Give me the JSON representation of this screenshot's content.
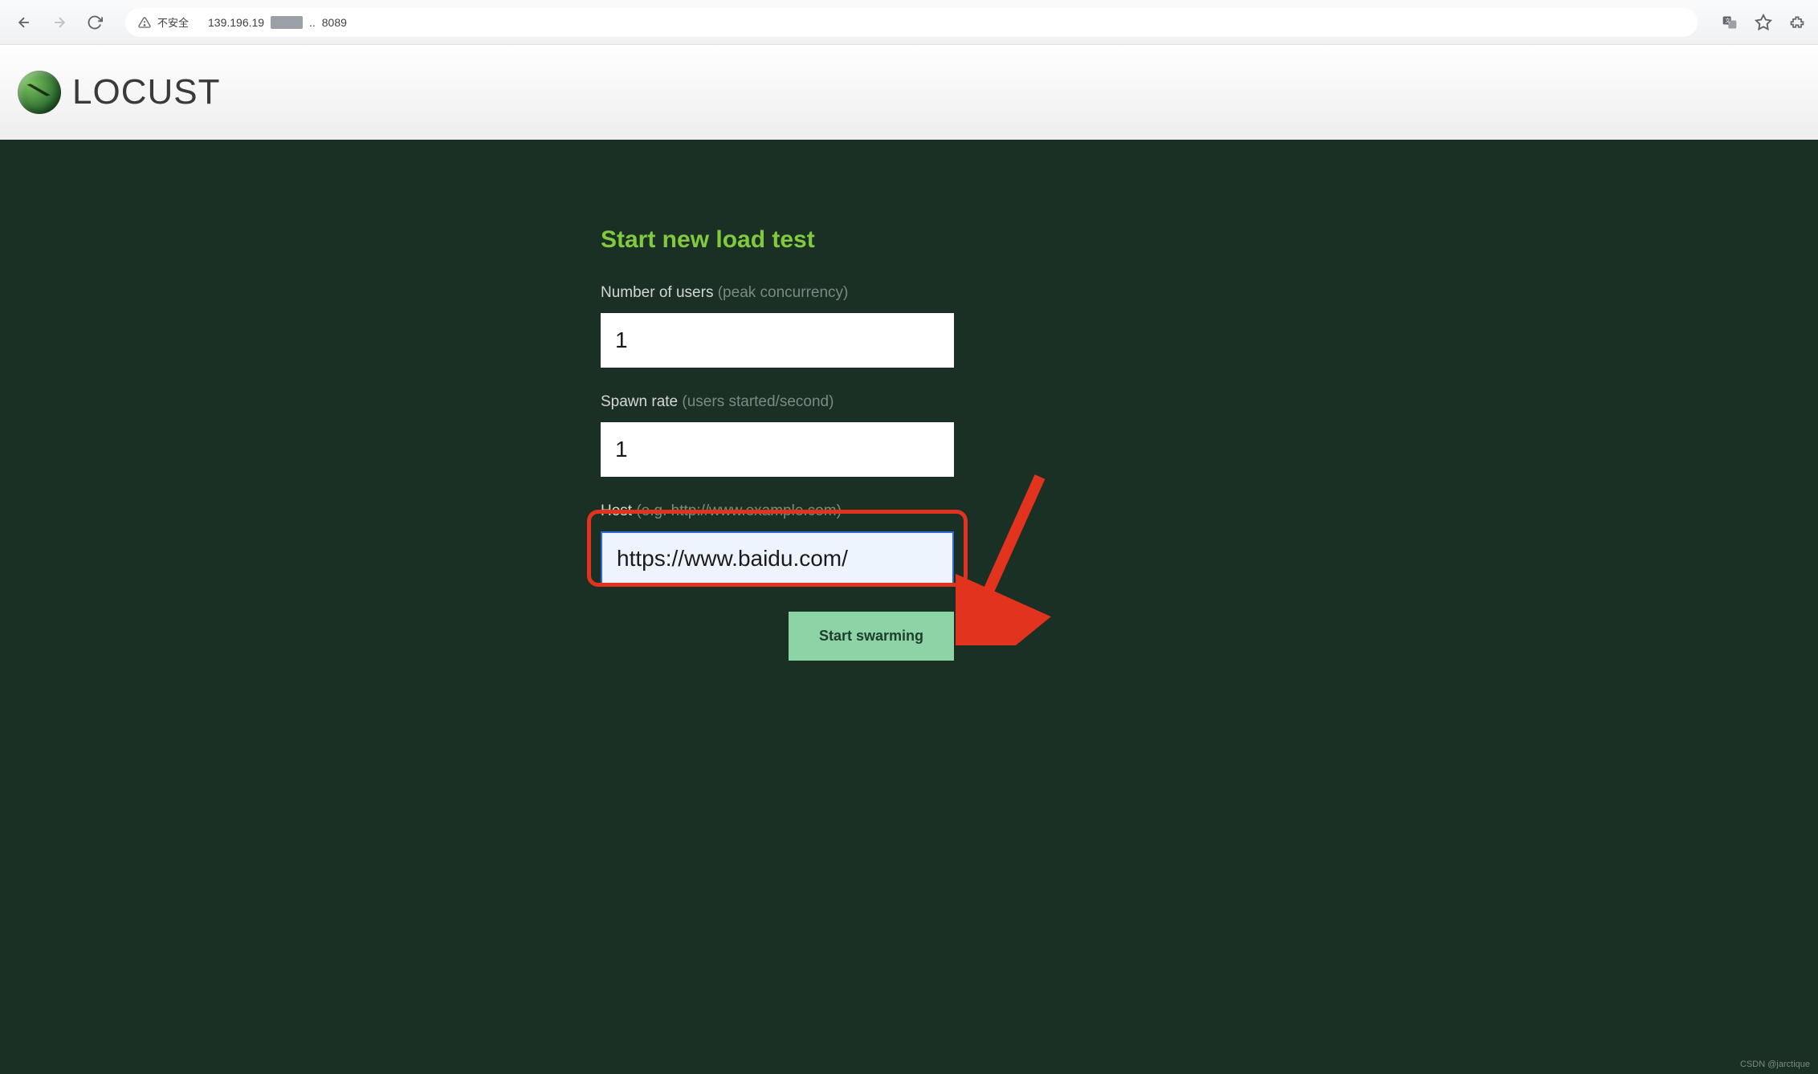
{
  "browser": {
    "insecure_label": "不安全",
    "url_visible_prefix": "139.196.19",
    "url_visible_suffix": "..",
    "url_port": "8089"
  },
  "header": {
    "product_name": "LOCUST"
  },
  "form": {
    "title": "Start new load test",
    "users_label": "Number of users",
    "users_hint": "(peak concurrency)",
    "users_value": "1",
    "spawn_label": "Spawn rate",
    "spawn_hint": "(users started/second)",
    "spawn_value": "1",
    "host_label": "Host",
    "host_hint": "(e.g. http://www.example.com)",
    "host_value": "https://www.baidu.com/",
    "submit_label": "Start swarming"
  },
  "watermark": "CSDN @jarctique"
}
